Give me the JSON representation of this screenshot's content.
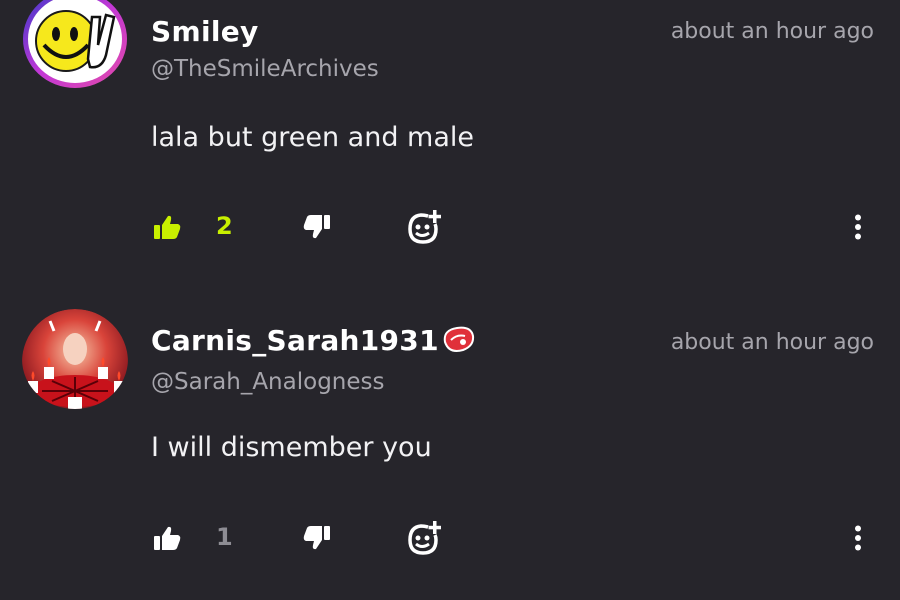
{
  "comments": [
    {
      "display_name": "Smiley",
      "handle": "@TheSmileArchives",
      "timestamp": "about an hour ago",
      "text": "lala but green and male",
      "like_count": "2",
      "liked": true,
      "avatar": "smiley-peace-avatar",
      "badge": ""
    },
    {
      "display_name": "Carnis_Sarah1931",
      "handle": "@Sarah_Analogness",
      "timestamp": "about an hour ago",
      "text": "I will dismember you",
      "like_count": "1",
      "liked": false,
      "avatar": "ritual-candles-avatar",
      "badge": "steak-icon"
    }
  ],
  "colors": {
    "background": "#26252b",
    "liked_accent": "#c8f000",
    "muted_text": "#a6a5ac"
  }
}
